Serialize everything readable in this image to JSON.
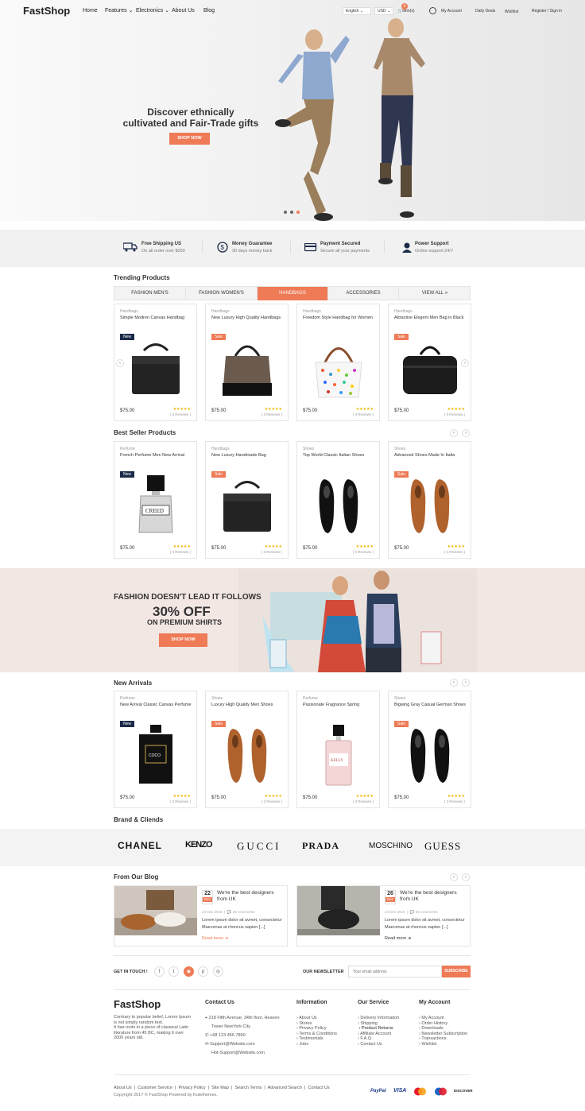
{
  "header": {
    "logo": "FastShop",
    "nav": [
      "Home",
      "Features",
      "Electronics",
      "About Us",
      "Blog"
    ],
    "language": "English",
    "currency": "USD",
    "cart_count": "0",
    "cart_label": "item(s)",
    "links": [
      "My Account",
      "Daily Deals",
      "Wishlist",
      "Register / Sign in"
    ]
  },
  "hero": {
    "title_line1": "Discover ethnically",
    "title_line2": "cultivated and Fair-Trade gifts",
    "button": "SHOP NOW"
  },
  "features": [
    {
      "title": "Free Shipping US",
      "sub": "On all order over $250",
      "icon": "truck-icon"
    },
    {
      "title": "Money Guarantee",
      "sub": "30 days money back",
      "icon": "dollar-icon"
    },
    {
      "title": "Payment Secured",
      "sub": "Secure all your payments",
      "icon": "card-icon"
    },
    {
      "title": "Power Support",
      "sub": "Online support 24/7",
      "icon": "support-icon"
    }
  ],
  "trending": {
    "title": "Trending Products",
    "tabs": [
      "FASHION MEN'S",
      "FASHION WOMEN'S",
      "HANDBAGS",
      "ACCESSORIES",
      "VIEW ALL"
    ],
    "active_tab": "HANDBAGS",
    "products": [
      {
        "cat": "Handbags",
        "name": "Simple Modren Canvas Handbag",
        "badge": "New",
        "price": "$75.00",
        "reviews": "( 3 Reviews )"
      },
      {
        "cat": "Handbags",
        "name": "New Luxury High Quality Handbags",
        "badge": "Sale",
        "price": "$75.00",
        "reviews": "( 3 Reviews )"
      },
      {
        "cat": "Handbags",
        "name": "Freedom Style Handbag for Women",
        "badge": "",
        "price": "$75.00",
        "reviews": "( 3 Reviews )"
      },
      {
        "cat": "Handbags",
        "name": "Attractive Elegent Men Bag in Black",
        "badge": "Sale",
        "price": "$75.00",
        "reviews": "( 3 Reviews )"
      }
    ]
  },
  "bestseller": {
    "title": "Best Seller Products",
    "products": [
      {
        "cat": "Perfume",
        "name": "French Perfume Men New Arrival",
        "badge": "New",
        "price": "$75.00",
        "reviews": "( 3 Reviews )"
      },
      {
        "cat": "Handbags",
        "name": "New Luxury Handmade Bag",
        "badge": "Sale",
        "price": "$75.00",
        "reviews": "( 3 Reviews )"
      },
      {
        "cat": "Shoes",
        "name": "Top World Classic Italian Shoes",
        "badge": "",
        "price": "$75.00",
        "reviews": "( 3 Reviews )"
      },
      {
        "cat": "Shoes",
        "name": "Advanced Shoes Made In Italia",
        "badge": "Sale",
        "price": "$75.00",
        "reviews": "( 3 Reviews )"
      }
    ]
  },
  "promo": {
    "line1": "FASHION DOESN'T LEAD IT FOLLOWS",
    "line2": "30% OFF",
    "line3": "ON PREMIUM SHIRTS",
    "button": "SHOP NOW"
  },
  "arrivals": {
    "title": "New Arrivals",
    "products": [
      {
        "cat": "Perfume",
        "name": "New Arrival Classic Canvas Perfume",
        "badge": "New",
        "price": "$75.00",
        "reviews": "( 3 Reviews )"
      },
      {
        "cat": "Shoes",
        "name": "Luxury High Quality Men Shoes",
        "badge": "Sale",
        "price": "$75.00",
        "reviews": "( 3 Reviews )"
      },
      {
        "cat": "Perfume",
        "name": "Passionate Fragrance Spring",
        "badge": "",
        "price": "$75.00",
        "reviews": "( 3 Reviews )"
      },
      {
        "cat": "Shoes",
        "name": "Bigwing Gray Casual German Shoes",
        "badge": "Sale",
        "price": "$75.00",
        "reviews": "( 3 Reviews )"
      }
    ]
  },
  "brands": {
    "title": "Brand & Cliends",
    "items": [
      "CHANEL",
      "KENZO",
      "GUCCI",
      "PRADA",
      "MOSCHINO",
      "GUESS"
    ]
  },
  "blog": {
    "title": "From Our Blog",
    "posts": [
      {
        "day": "22",
        "month": "Dec",
        "title": "We're the best designers from UK",
        "date": "23 Dec 2016",
        "comments": "36 Comments",
        "excerpt1": "Lorem ipsum dolor sit avmet, consectetur",
        "excerpt2": "Maecenas at rhoncus sapien [...]",
        "more": "Read more"
      },
      {
        "day": "26",
        "month": "Dec",
        "title": "We're the best designers from UK",
        "date": "23 Dec 2016",
        "comments": "36 Comments",
        "excerpt1": "Lorem ipsum dolor sit avmet, consectetur",
        "excerpt2": "Maecenas at rhoncus sapien [...]",
        "more": "Read more"
      }
    ]
  },
  "social": {
    "label": "GET IN TOUCH !",
    "newsletter": "OUR NEWSLETTER",
    "placeholder": "Your email address",
    "subscribe": "SUBSCRIBE"
  },
  "footer": {
    "logo": "FastShop",
    "about": [
      "Contrary to popular belief, Lorem Ipsum",
      "is not simply random text.",
      "It has roots in a piece of classical Latin",
      "literature from 45 BC, making it over",
      "2000 years old."
    ],
    "contact_title": "Contact Us",
    "address1": "218 Fifth Avenue, 34th floor, Heaven",
    "address2": "Tower NewYork City",
    "phone": "+68 123 456 7890",
    "email1": "Support@Website.com",
    "email2": "Hot-Support@Website.com",
    "info_title": "Information",
    "info": [
      "About Us",
      "Stores",
      "Privacy Policy",
      "Terms & Conditions",
      "Testimonials",
      "Jobs"
    ],
    "service_title": "Our Service",
    "service": [
      "Delivery Information",
      "Shipping",
      "Product Returns",
      "Affiliate Account",
      "F.A.Q",
      "Contact Us"
    ],
    "account_title": "My Account",
    "account": [
      "My Account",
      "Order History",
      "Downloads",
      "Newsletter Subscription",
      "Transactions",
      "Wishlist"
    ],
    "bottom_links": [
      "About Us",
      "Customer Service",
      "Privacy Policy",
      "Site Map",
      "Search Terms",
      "Advanced Search",
      "Contact Us"
    ],
    "copyright": "Copyright 2017 © FastShop Powered by Kutethemes.",
    "payments": [
      "PayPal",
      "VISA",
      "mastercard",
      "maestro",
      "DISCOVER"
    ]
  },
  "colors": {
    "accent": "#ee7a56",
    "navy": "#1b2a48"
  }
}
